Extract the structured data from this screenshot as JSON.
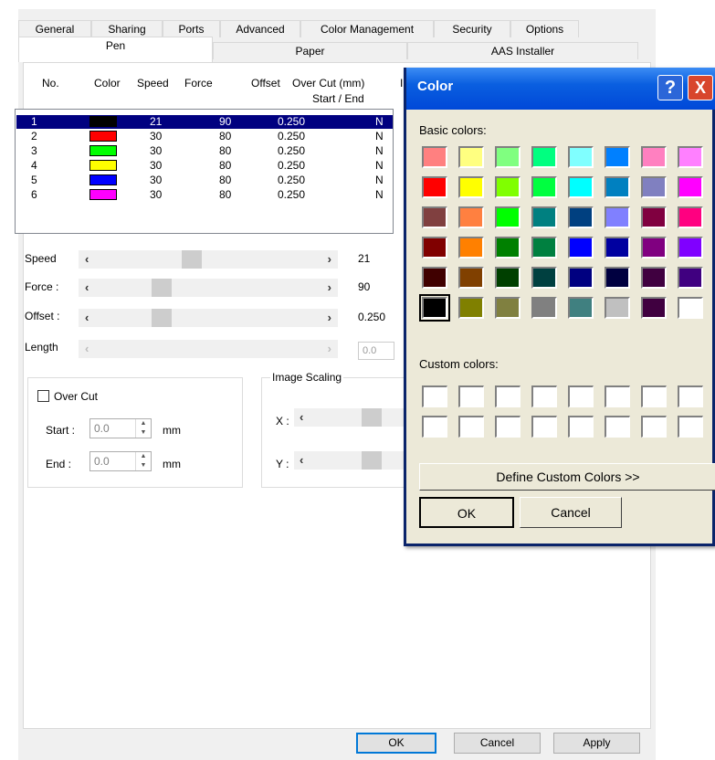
{
  "tabs_top": [
    "General",
    "Sharing",
    "Ports",
    "Advanced",
    "Color Management",
    "Security",
    "Options"
  ],
  "tabs_bottom": [
    "Pen",
    "Paper",
    "AAS Installer"
  ],
  "pen_headers": {
    "no": "No.",
    "color": "Color",
    "speed": "Speed",
    "force": "Force",
    "offset": "Offset",
    "overcut": "Over Cut (mm)",
    "startend": "Start / End",
    "extra": "I"
  },
  "pens": [
    {
      "no": "1",
      "color": "#000000",
      "speed": "21",
      "force": "90",
      "offset": "0.250",
      "flag": "N"
    },
    {
      "no": "2",
      "color": "#ff0000",
      "speed": "30",
      "force": "80",
      "offset": "0.250",
      "flag": "N"
    },
    {
      "no": "3",
      "color": "#00ff00",
      "speed": "30",
      "force": "80",
      "offset": "0.250",
      "flag": "N"
    },
    {
      "no": "4",
      "color": "#ffff00",
      "speed": "30",
      "force": "80",
      "offset": "0.250",
      "flag": "N"
    },
    {
      "no": "5",
      "color": "#0000ff",
      "speed": "30",
      "force": "80",
      "offset": "0.250",
      "flag": "N"
    },
    {
      "no": "6",
      "color": "#ff00ff",
      "speed": "30",
      "force": "80",
      "offset": "0.250",
      "flag": "N"
    }
  ],
  "selected_pen": "1",
  "sliders": {
    "speed": {
      "label": "Speed",
      "value": "21",
      "level": 0.42
    },
    "force": {
      "label": "Force :",
      "value": "90",
      "level": 0.27
    },
    "offset": {
      "label": "Offset :",
      "value": "0.250",
      "level": 0.27
    },
    "length": {
      "label": "Length",
      "value": "0.0"
    }
  },
  "overcut": {
    "label": "Over Cut",
    "start_label": "Start :",
    "start_value": "0.0",
    "end_label": "End :",
    "end_value": "0.0",
    "unit": "mm"
  },
  "image_scaling": {
    "label": "Image Scaling",
    "x_label": "X :",
    "y_label": "Y :"
  },
  "footer": {
    "ok": "OK",
    "cancel": "Cancel",
    "apply": "Apply"
  },
  "color_dialog": {
    "title": "Color",
    "help": "?",
    "close": "X",
    "basic_label": "Basic colors:",
    "custom_label": "Custom colors:",
    "define_button": "Define Custom Colors >>",
    "ok": "OK",
    "cancel": "Cancel",
    "basic_colors": [
      "#ff8080",
      "#ffff80",
      "#80ff80",
      "#00ff80",
      "#80ffff",
      "#0080ff",
      "#ff80c0",
      "#ff80ff",
      "#ff0000",
      "#ffff00",
      "#80ff00",
      "#00ff40",
      "#00ffff",
      "#0080c0",
      "#8080c0",
      "#ff00ff",
      "#804040",
      "#ff8040",
      "#00ff00",
      "#008080",
      "#004080",
      "#8080ff",
      "#800040",
      "#ff0080",
      "#800000",
      "#ff8000",
      "#008000",
      "#008040",
      "#0000ff",
      "#0000a0",
      "#800080",
      "#8000ff",
      "#400000",
      "#804000",
      "#004000",
      "#004040",
      "#000080",
      "#000040",
      "#400040",
      "#400080",
      "#000000",
      "#808000",
      "#808040",
      "#808080",
      "#408080",
      "#c0c0c0",
      "#400040",
      "#ffffff"
    ]
  }
}
